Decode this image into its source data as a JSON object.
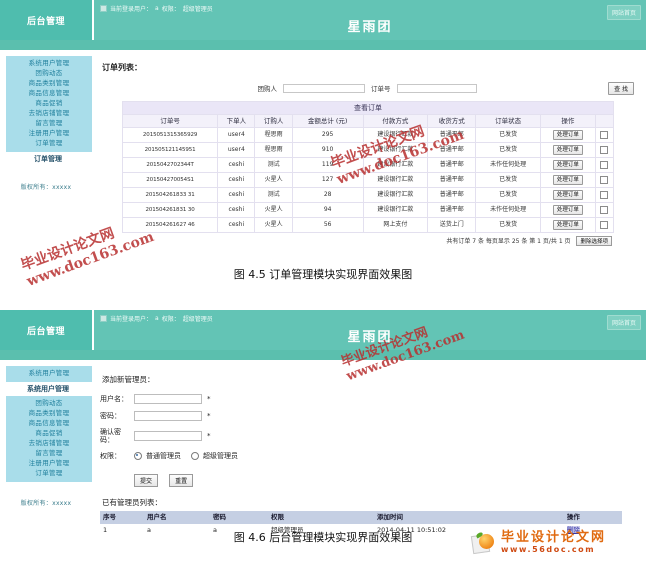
{
  "header": {
    "brand": "后台管理",
    "login_prefix": "当前登录用户：",
    "login_user": "a",
    "role_label": "权限：",
    "role_value": "超级管理员",
    "site_title": "星雨团",
    "home_button": "网站首页",
    "accent": "#5bbfae"
  },
  "sidebar": {
    "items": [
      {
        "label": "系统用户管理"
      },
      {
        "label": "团购动态"
      },
      {
        "label": "商品类别管理"
      },
      {
        "label": "商品信息管理"
      },
      {
        "label": "商品促销"
      },
      {
        "label": "去销店铺管理"
      },
      {
        "label": "留言管理"
      },
      {
        "label": "注册用户管理"
      },
      {
        "label": "订单管理"
      }
    ],
    "active_orders": "订单管理",
    "active_users": "系统用户管理",
    "copyright": "版权所有：xxxxx"
  },
  "orders_page": {
    "section_title": "订单列表：",
    "search": {
      "buyer_label": "团购人",
      "buyer_value": "",
      "buyer_placeholder": "",
      "order_label": "订单号",
      "order_value": "",
      "order_placeholder": "",
      "search_button": "查 找"
    },
    "table": {
      "caption": "查看订单",
      "columns": [
        "订单号",
        "下单人",
        "订购人",
        "金额总计 (元)",
        "付款方式",
        "收货方式",
        "订单状态",
        "操作",
        ""
      ],
      "action_label": "处理订单",
      "rows": [
        {
          "order_no": "20150513153659​29",
          "placer": "user4",
          "buyer": "程思雨",
          "amount": "295",
          "pay": "建设银行汇款",
          "ship": "普通平邮",
          "status": "已发货"
        },
        {
          "order_no": "201505121145951",
          "placer": "user4",
          "buyer": "程思雨",
          "amount": "910",
          "pay": "建设银行汇款",
          "ship": "普通平邮",
          "status": "已发货"
        },
        {
          "order_no": "2015042702344T",
          "placer": "ceshi",
          "buyer": "测试",
          "amount": "119",
          "pay": "建设银行汇款",
          "ship": "普通平邮",
          "status": "未作任何处理"
        },
        {
          "order_no": "201504270054S1",
          "placer": "ceshi",
          "buyer": "火星人",
          "amount": "127",
          "pay": "建设银行汇款",
          "ship": "普通平邮",
          "status": "已发货"
        },
        {
          "order_no": "201504261833 31",
          "placer": "ceshi",
          "buyer": "测试",
          "amount": "28",
          "pay": "建设银行汇款",
          "ship": "普通平邮",
          "status": "已发货"
        },
        {
          "order_no": "201504261831 30",
          "placer": "ceshi",
          "buyer": "火星人",
          "amount": "94",
          "pay": "建设银行汇款",
          "ship": "普通平邮",
          "status": "未作任何处理"
        },
        {
          "order_no": "201504261627 46",
          "placer": "ceshi",
          "buyer": "火星人",
          "amount": "56",
          "pay": "网上支付",
          "ship": "送货上门",
          "status": "已发货"
        }
      ]
    },
    "pager": {
      "text": "共有订单 7 条 每页显示 25 条 第 1 页/共 1 页",
      "delete_button": "删除选择项"
    }
  },
  "admin_page": {
    "form_title": "添加新管理员：",
    "fields": [
      {
        "label": "用户名：",
        "value": "",
        "required": "*"
      },
      {
        "label": "密码：",
        "value": "",
        "required": "*"
      },
      {
        "label": "确认密码：",
        "value": "",
        "required": "*"
      }
    ],
    "permission": {
      "label": "权限：",
      "options": [
        "普通管理员",
        "超级管理员"
      ],
      "selected": "普通管理员"
    },
    "submit_button": "提交",
    "reset_button": "重置",
    "list_title": "已有管理员列表：",
    "table": {
      "columns": [
        "序号",
        "用户名",
        "密码",
        "权限",
        "添加时间",
        "操作"
      ],
      "rows": [
        {
          "index": "1",
          "username": "a",
          "password": "a",
          "role": "超级管理员",
          "created": "2014-04-11  10:51:02",
          "action": "删除"
        }
      ]
    }
  },
  "captions": {
    "fig_45": "图 4.5  订单管理模块实现界面效果图",
    "fig_46": "图 4.6  后台管理模块实现界面效果图"
  },
  "watermarks": {
    "cn": "毕业设计论文网",
    "url": "www.doc163.com",
    "color": "#b83030"
  },
  "logo": {
    "cn": "毕业设计论文网",
    "en": "www.56doc.com"
  }
}
